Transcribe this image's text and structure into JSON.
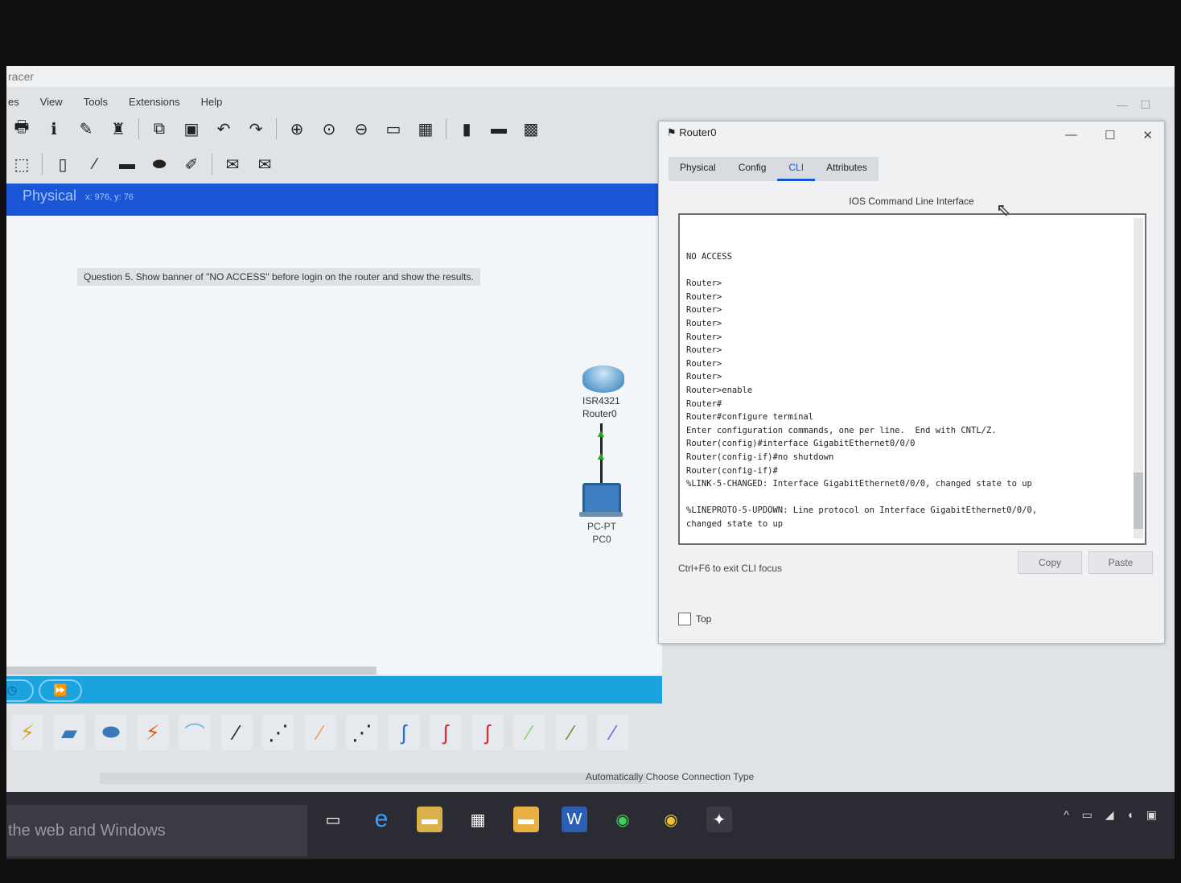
{
  "app": {
    "title": "racer"
  },
  "menu": [
    "es",
    "View",
    "Tools",
    "Extensions",
    "Help"
  ],
  "physical_bar": {
    "label": "Physical",
    "coords": "x: 976, y: 76"
  },
  "question": "Question 5. Show banner of \"NO ACCESS\" before login on the router and show the results.",
  "devices": {
    "router": {
      "model": "ISR4321",
      "name": "Router0"
    },
    "pc": {
      "model": "PC-PT",
      "name": "PC0"
    }
  },
  "connection_label": "Automatically Choose Connection Type",
  "taskbar": {
    "search": "the web and Windows"
  },
  "router_window": {
    "title": "Router0",
    "tabs": [
      "Physical",
      "Config",
      "CLI",
      "Attributes"
    ],
    "subtitle": "IOS Command Line Interface",
    "cli_lines": [
      "NO ACCESS",
      "",
      "Router>",
      "Router>",
      "Router>",
      "Router>",
      "Router>",
      "Router>",
      "Router>",
      "Router>",
      "Router>enable",
      "Router#",
      "Router#configure terminal",
      "Enter configuration commands, one per line.  End with CNTL/Z.",
      "Router(config)#interface GigabitEthernet0/0/0",
      "Router(config-if)#no shutdown",
      "Router(config-if)#",
      "%LINK-5-CHANGED: Interface GigabitEthernet0/0/0, changed state to up",
      "",
      "%LINEPROTO-5-UPDOWN: Line protocol on Interface GigabitEthernet0/0/0,",
      "changed state to up"
    ],
    "hint": "Ctrl+F6 to exit CLI focus",
    "copy_label": "Copy",
    "paste_label": "Paste",
    "top_label": "Top"
  },
  "colors": {
    "accent": "#1a56d6",
    "timebar": "#1ba3e0",
    "taskbar": "#2b2b33"
  }
}
